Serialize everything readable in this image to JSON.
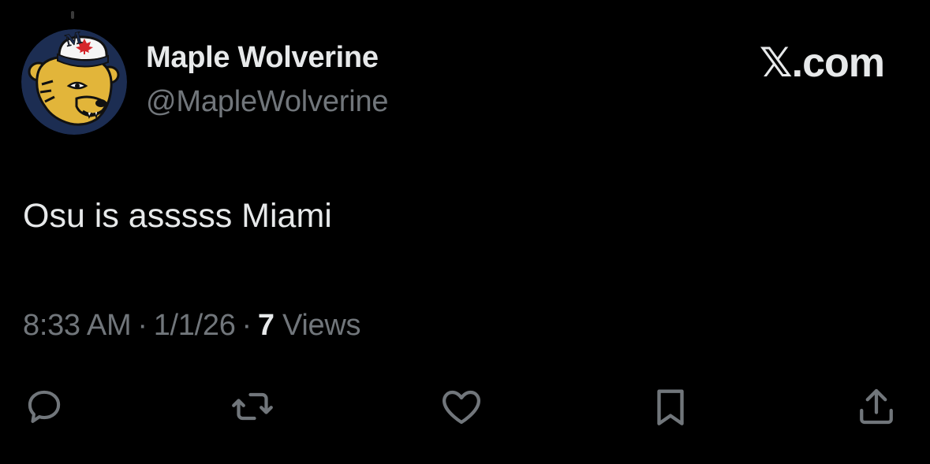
{
  "header": {
    "display_name": "Maple Wolverine",
    "handle": "@MapleWolverine",
    "brand": "𝕏.com"
  },
  "avatar": {
    "logo_text": "M"
  },
  "tweet": {
    "text": "Osu is asssss Miami"
  },
  "meta": {
    "time": "8:33 AM",
    "date": "1/1/26",
    "separator": "·",
    "views_count": "7",
    "views_label": "Views"
  },
  "actions": [
    {
      "name": "reply",
      "icon": "reply-icon"
    },
    {
      "name": "repost",
      "icon": "repost-icon"
    },
    {
      "name": "like",
      "icon": "heart-icon"
    },
    {
      "name": "bookmark",
      "icon": "bookmark-icon"
    },
    {
      "name": "share",
      "icon": "share-icon"
    }
  ],
  "colors": {
    "background": "#000000",
    "primary_text": "#e7e9ea",
    "secondary_text": "#71767b",
    "avatar_navy": "#1c2d52",
    "avatar_maize": "#e2b53a",
    "maple_leaf_red": "#d5272c"
  }
}
